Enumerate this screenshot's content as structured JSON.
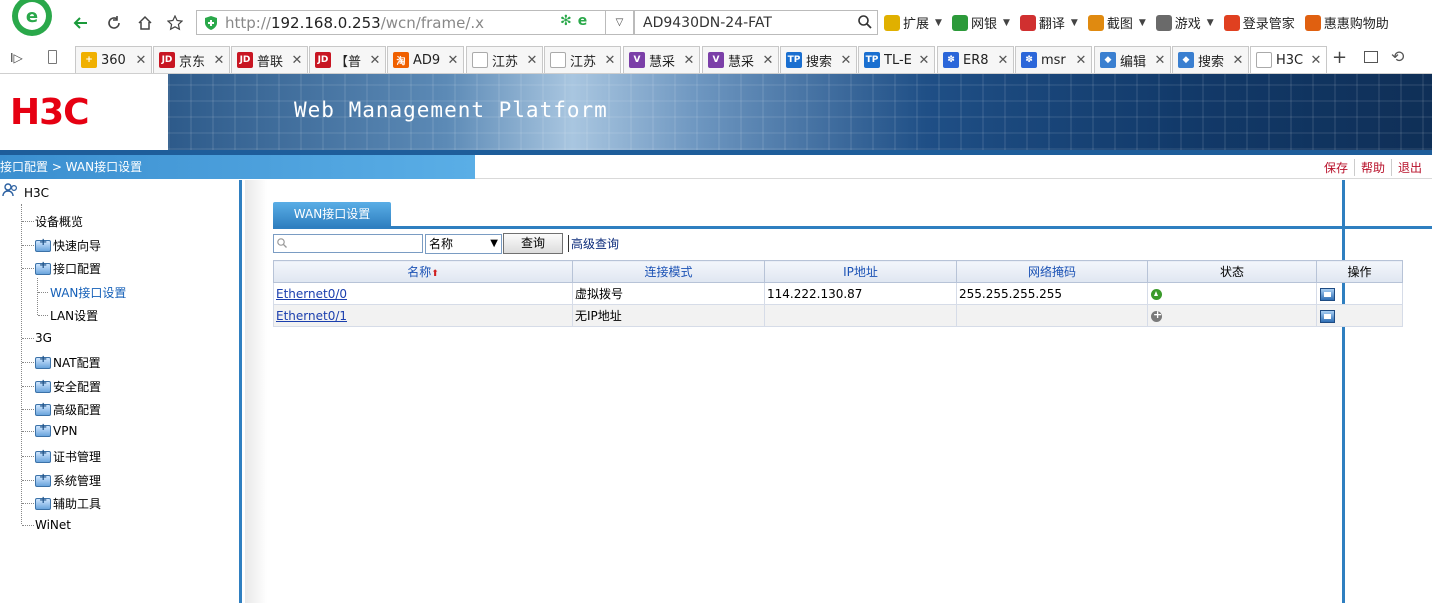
{
  "browser": {
    "url_prefix": "http://",
    "url_host": "192.168.0.253",
    "url_path": "/wcn/frame/.x",
    "search_value": "AD9430DN-24-FAT",
    "extensions": [
      {
        "label": "扩展",
        "color": "#e0b000",
        "caret": true
      },
      {
        "label": "网银",
        "color": "#2c9a3a",
        "caret": true
      },
      {
        "label": "翻译",
        "color": "#d03030",
        "caret": true
      },
      {
        "label": "截图",
        "color": "#e08a10",
        "caret": true
      },
      {
        "label": "游戏",
        "color": "#6a6a6a",
        "caret": true
      },
      {
        "label": "登录管家",
        "color": "#e04020",
        "caret": false
      },
      {
        "label": "惠惠购物助",
        "color": "#e06010",
        "caret": false
      }
    ],
    "tabs": [
      {
        "label": "360",
        "fav": "+",
        "color": "#f0b000"
      },
      {
        "label": "京东",
        "fav": "JD",
        "color": "#c81623"
      },
      {
        "label": "普联",
        "fav": "JD",
        "color": "#c81623"
      },
      {
        "label": "【普",
        "fav": "JD",
        "color": "#c81623"
      },
      {
        "label": "AD9",
        "fav": "淘",
        "color": "#f06000"
      },
      {
        "label": "江苏",
        "fav": "",
        "color": "#cccccc"
      },
      {
        "label": "江苏",
        "fav": "",
        "color": "#cccccc"
      },
      {
        "label": "慧采",
        "fav": "V",
        "color": "#7b3fa8"
      },
      {
        "label": "慧采",
        "fav": "V",
        "color": "#7b3fa8"
      },
      {
        "label": "搜索",
        "fav": "TP",
        "color": "#1a6fd0"
      },
      {
        "label": "TL-E",
        "fav": "TP",
        "color": "#1a6fd0"
      },
      {
        "label": "ER8",
        "fav": "✽",
        "color": "#2b66d9"
      },
      {
        "label": "msr",
        "fav": "✽",
        "color": "#2b66d9"
      },
      {
        "label": "编辑",
        "fav": "◆",
        "color": "#3a7fd0"
      },
      {
        "label": "搜索",
        "fav": "◆",
        "color": "#3a7fd0"
      },
      {
        "label": "H3C",
        "fav": "",
        "color": "#cccccc"
      }
    ]
  },
  "page": {
    "logo_text": "H3C",
    "banner_title": "Web Management Platform",
    "breadcrumb": "接口配置 > WAN接口设置",
    "top_links": [
      "保存",
      "帮助",
      "退出"
    ]
  },
  "sidebar": {
    "root": "H3C",
    "items": [
      {
        "label": "设备概览",
        "folder": false
      },
      {
        "label": "快速向导",
        "folder": true
      },
      {
        "label": "接口配置",
        "folder": true
      },
      {
        "label": "3G",
        "folder": false
      },
      {
        "label": "NAT配置",
        "folder": true
      },
      {
        "label": "安全配置",
        "folder": true
      },
      {
        "label": "高级配置",
        "folder": true
      },
      {
        "label": "VPN",
        "folder": true
      },
      {
        "label": "证书管理",
        "folder": true
      },
      {
        "label": "系统管理",
        "folder": true
      },
      {
        "label": "辅助工具",
        "folder": true
      },
      {
        "label": "WiNet",
        "folder": false
      }
    ],
    "subitems": [
      {
        "label": "WAN接口设置",
        "active": true
      },
      {
        "label": "LAN设置",
        "active": false
      }
    ]
  },
  "content": {
    "tab_label": "WAN接口设置",
    "search_placeholder": "",
    "select_value": "名称",
    "query_button": "查询",
    "advanced_link": "高级查询",
    "columns": [
      "名称",
      "连接模式",
      "IP地址",
      "网络掩码",
      "状态",
      "操作"
    ],
    "sort_indicator": "⬆",
    "rows": [
      {
        "name": "Ethernet0/0",
        "mode": "虚拟拨号",
        "ip": "114.222.130.87",
        "mask": "255.255.255.255",
        "status": "up"
      },
      {
        "name": "Ethernet0/1",
        "mode": "无IP地址",
        "ip": "",
        "mask": "",
        "status": "down"
      }
    ]
  }
}
